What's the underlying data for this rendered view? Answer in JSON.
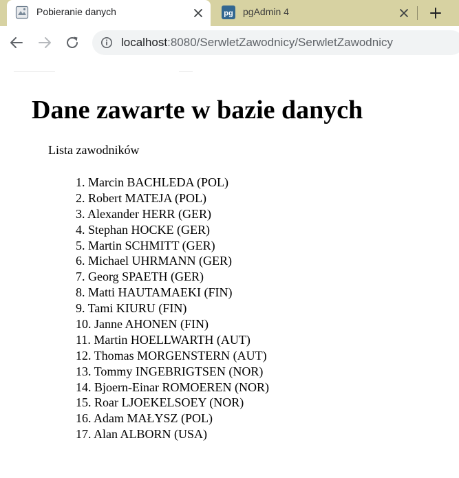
{
  "browser": {
    "tabs": [
      {
        "title": "Pobieranie danych",
        "active": true,
        "icon": "page-favicon"
      },
      {
        "title": "pgAdmin 4",
        "active": false,
        "icon": "pgadmin-favicon"
      }
    ],
    "url": {
      "host": "localhost",
      "path": ":8080/SerwletZawodnicy/SerwletZawodnicy"
    },
    "colors": {
      "tabstrip": "#d7d2a2",
      "pgadmin_icon": "#336791"
    }
  },
  "page": {
    "title": "Dane zawarte w bazie danych",
    "list_heading": "Lista zawodników",
    "players": [
      "1. Marcin BACHLEDA (POL)",
      "2. Robert MATEJA (POL)",
      "3. Alexander HERR (GER)",
      "4. Stephan HOCKE (GER)",
      "5. Martin SCHMITT (GER)",
      "6. Michael UHRMANN (GER)",
      "7. Georg SPAETH (GER)",
      "8. Matti HAUTAMAEKI (FIN)",
      "9. Tami KIURU (FIN)",
      "10. Janne AHONEN (FIN)",
      "11. Martin HOELLWARTH (AUT)",
      "12. Thomas MORGENSTERN (AUT)",
      "13. Tommy INGEBRIGTSEN (NOR)",
      "14. Bjoern-Einar ROMOEREN (NOR)",
      "15. Roar LJOEKELSOEY (NOR)",
      "16. Adam MAŁYSZ (POL)",
      "17. Alan ALBORN (USA)"
    ]
  }
}
